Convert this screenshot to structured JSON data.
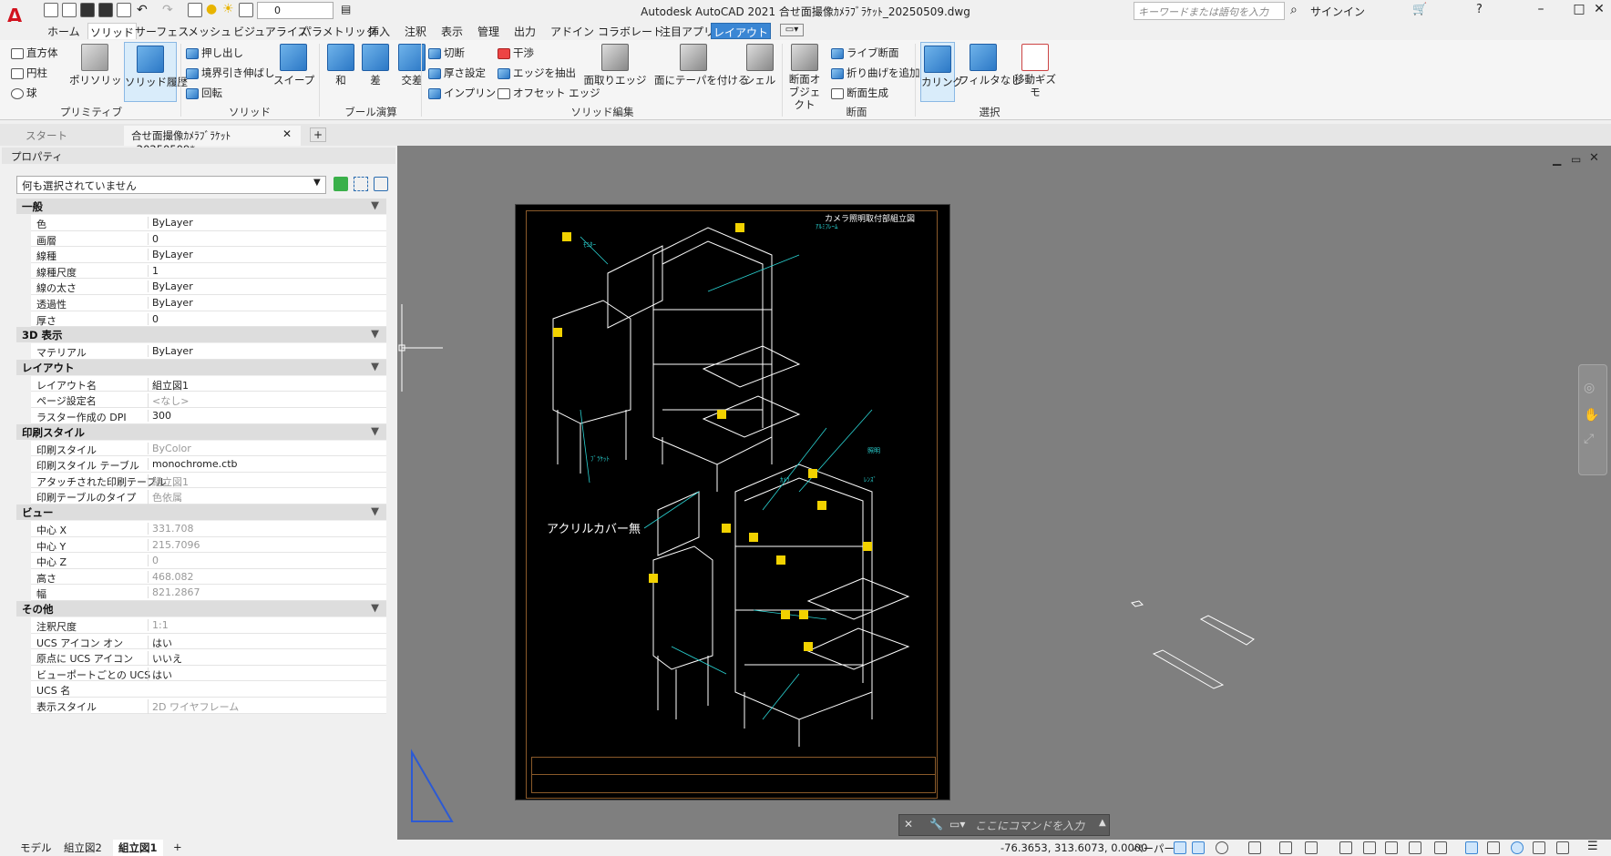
{
  "window": {
    "title": "Autodesk AutoCAD 2021    合せ面撮像ｶﾒﾗﾌﾞﾗｹｯﾄ_20250509.dwg",
    "workspace_layer": "0",
    "search_placeholder": "キーワードまたは語句を入力",
    "signin": "サインイン"
  },
  "ribbon_tabs": [
    "ホーム",
    "ソリッド",
    "サーフェス",
    "メッシュ",
    "ビジュアライズ",
    "パラメトリック",
    "挿入",
    "注釈",
    "表示",
    "管理",
    "出力",
    "アドイン",
    "コラボレート",
    "注目アプリ",
    "レイアウト"
  ],
  "ribbon": {
    "primitive": {
      "box": "直方体",
      "cylinder": "円柱",
      "sphere": "球",
      "polysolid": "ポリソリッド",
      "history": "ソリッド履歴",
      "group": "プリミティブ"
    },
    "solid": {
      "extrude": "押し出し",
      "presspull": "境界引き伸ばし",
      "revolve": "回転",
      "sweep": "スイープ",
      "group": "ソリッド"
    },
    "boolean": {
      "union": "和",
      "subtract": "差",
      "intersect": "交差",
      "group": "ブール演算"
    },
    "solidedit": {
      "slice": "切断",
      "thicken": "厚さ設定",
      "imprint": "インプリント",
      "interfere": "干渉",
      "extract_edges": "エッジを抽出",
      "offset_edge": "オフセット エッジ",
      "fillet_edge": "面取りエッジ",
      "taper_faces": "面にテーパを付ける",
      "shell": "シェル",
      "group": "ソリッド編集"
    },
    "section": {
      "section_plane": "断面オブジェクト",
      "live_section": "ライブ断面",
      "add_jog": "折り曲げを追加",
      "generate_section": "断面生成",
      "group": "断面"
    },
    "selection": {
      "culling": "カリング",
      "no_filter": "フィルタなし",
      "move_gizmo": "移動ギズモ",
      "group": "選択"
    }
  },
  "doc_tabs": [
    "スタート",
    "合せ面撮像ｶﾒﾗﾌﾞﾗｹｯﾄ_20250509*"
  ],
  "properties": {
    "title": "プロパティ",
    "selection": "何も選択されていません",
    "sections": [
      {
        "name": "一般",
        "rows": [
          [
            "色",
            "ByLayer"
          ],
          [
            "画層",
            "0"
          ],
          [
            "線種",
            "ByLayer"
          ],
          [
            "線種尺度",
            "1"
          ],
          [
            "線の太さ",
            "ByLayer"
          ],
          [
            "透過性",
            "ByLayer"
          ],
          [
            "厚さ",
            "0"
          ]
        ]
      },
      {
        "name": "3D 表示",
        "rows": [
          [
            "マテリアル",
            "ByLayer"
          ]
        ]
      },
      {
        "name": "レイアウト",
        "rows": [
          [
            "レイアウト名",
            "組立図1"
          ],
          [
            "ページ設定名",
            "<なし>"
          ],
          [
            "ラスター作成の DPI",
            "300"
          ]
        ]
      },
      {
        "name": "印刷スタイル",
        "rows": [
          [
            "印刷スタイル",
            "ByColor"
          ],
          [
            "印刷スタイル テーブル",
            "monochrome.ctb"
          ],
          [
            "アタッチされた印刷テーブル",
            "組立図1"
          ],
          [
            "印刷テーブルのタイプ",
            "色依属"
          ]
        ]
      },
      {
        "name": "ビュー",
        "rows": [
          [
            "中心 X",
            "331.708"
          ],
          [
            "中心 Y",
            "215.7096"
          ],
          [
            "中心 Z",
            "0"
          ],
          [
            "高さ",
            "468.082"
          ],
          [
            "幅",
            "821.2867"
          ]
        ]
      },
      {
        "name": "その他",
        "rows": [
          [
            "注釈尺度",
            "1:1"
          ],
          [
            "UCS アイコン オン",
            "はい"
          ],
          [
            "原点に UCS アイコン",
            "いいえ"
          ],
          [
            "ビューポートごとの UCS",
            "はい"
          ],
          [
            "UCS 名",
            ""
          ],
          [
            "表示スタイル",
            "2D ワイヤフレーム"
          ]
        ]
      }
    ]
  },
  "drawing": {
    "title": "カメラ照明取付部組立図",
    "note": "アクリルカバー無",
    "labels": [
      "ﾓﾆﾀｰ",
      "ｱﾙﾐﾌﾚｰﾑ",
      "ﾌﾞﾗｹｯﾄ",
      "照明",
      "ﾚﾝｽﾞ",
      "ｶﾒﾗ"
    ]
  },
  "command": {
    "placeholder": "ここにコマンドを入力"
  },
  "layout_tabs": [
    "モデル",
    "組立図2",
    "組立図1"
  ],
  "status": {
    "coords": "-76.3653, 313.6073, 0.0000",
    "space": "ペーパー"
  }
}
